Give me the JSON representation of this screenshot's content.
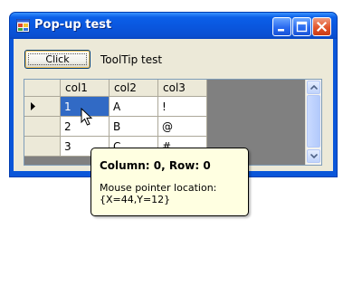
{
  "window": {
    "title": "Pop-up test"
  },
  "toolbar": {
    "click_label": "Click",
    "tooltip_label": "ToolTip test"
  },
  "grid": {
    "columns": [
      "col1",
      "col2",
      "col3"
    ],
    "rows": [
      [
        "1",
        "A",
        "!"
      ],
      [
        "2",
        "B",
        "@"
      ],
      [
        "3",
        "C",
        "#"
      ]
    ]
  },
  "tooltip": {
    "title": "Column: 0, Row: 0",
    "line1": "Mouse pointer location:",
    "line2": "{X=44,Y=12}"
  },
  "icons": {
    "app": "app-window-icon",
    "minimize": "minimize-icon",
    "maximize": "maximize-icon",
    "close": "close-icon",
    "current_row": "row-pointer-icon",
    "cursor": "mouse-pointer-icon"
  },
  "colors": {
    "titlebar": "#0a55dc",
    "selection": "#316ac5",
    "tooltip_bg": "#ffffe1",
    "close_button": "#e2552b"
  }
}
